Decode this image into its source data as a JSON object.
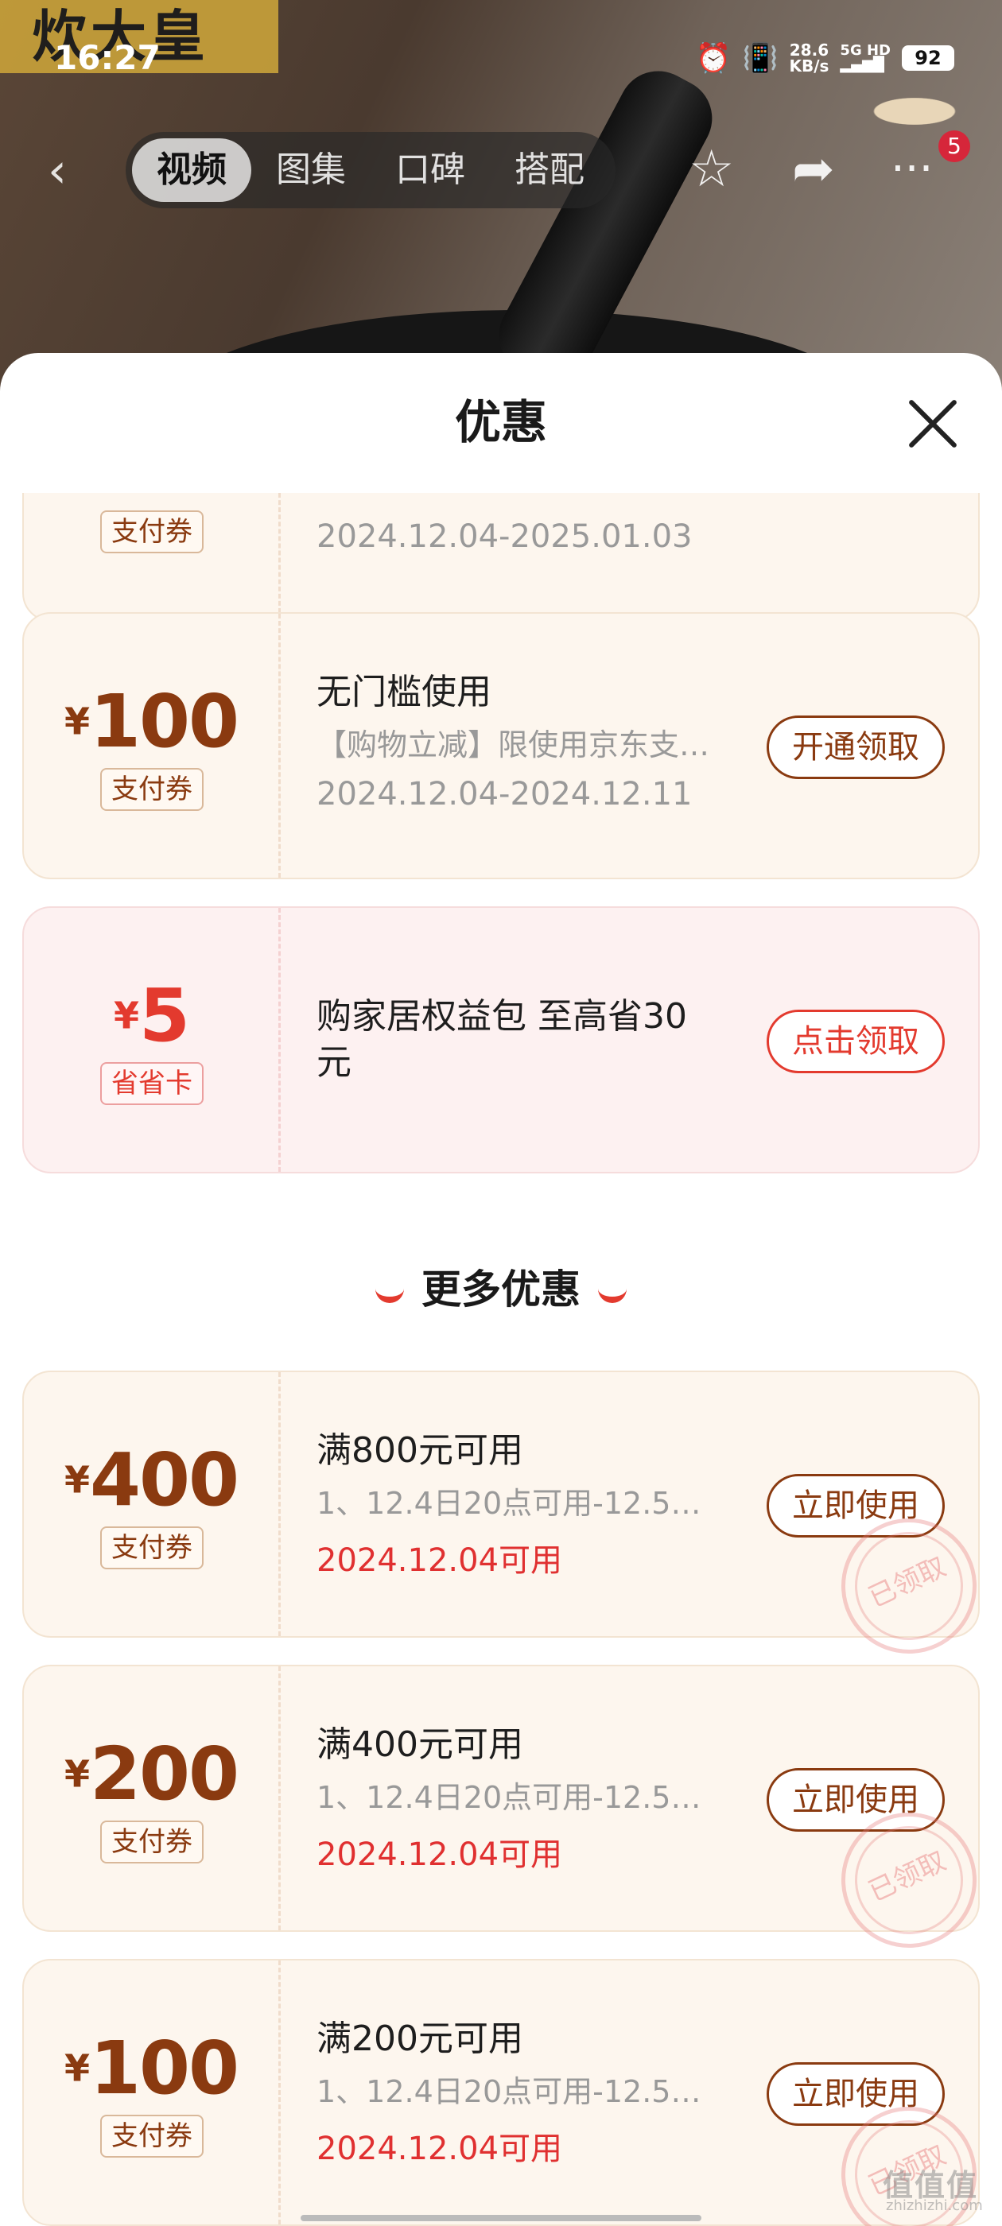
{
  "status_bar": {
    "time": "16:27",
    "net_speed_value": "28.6",
    "net_speed_unit": "KB/s",
    "network": "5G HD",
    "battery": "92"
  },
  "header": {
    "brand": "炊大皇",
    "tabs": [
      {
        "label": "视频",
        "active": true
      },
      {
        "label": "图集",
        "active": false
      },
      {
        "label": "口碑",
        "active": false
      },
      {
        "label": "搭配",
        "active": false
      }
    ],
    "badge_count": "5"
  },
  "sheet": {
    "title": "优惠",
    "partial_coupon": {
      "tag": "支付券",
      "date": "2024.12.04-2025.01.03"
    },
    "coupons": [
      {
        "currency": "¥",
        "amount": "100",
        "tag": "支付券",
        "title": "无门槛使用",
        "desc": "【购物立减】限使用京东支…",
        "date": "2024.12.04-2024.12.11",
        "button": "开通领取"
      },
      {
        "currency": "¥",
        "amount": "5",
        "tag": "省省卡",
        "title": "购家居权益包 至高省30",
        "title_line2": "元",
        "button": "点击领取"
      }
    ],
    "more_section_title": "更多优惠",
    "more_coupons": [
      {
        "currency": "¥",
        "amount": "400",
        "tag": "支付券",
        "title": "满800元可用",
        "desc": "1、12.4日20点可用-12.5…",
        "date": "2024.12.04可用",
        "button": "立即使用",
        "stamp": "已领取"
      },
      {
        "currency": "¥",
        "amount": "200",
        "tag": "支付券",
        "title": "满400元可用",
        "desc": "1、12.4日20点可用-12.5…",
        "date": "2024.12.04可用",
        "button": "立即使用",
        "stamp": "已领取"
      },
      {
        "currency": "¥",
        "amount": "100",
        "tag": "支付券",
        "title": "满200元可用",
        "desc": "1、12.4日20点可用-12.5…",
        "date": "2024.12.04可用",
        "button": "立即使用",
        "stamp": "已领取"
      }
    ]
  },
  "watermark": {
    "text": "值值值",
    "sub": "zhizhizhi.com"
  },
  "colors": {
    "brown_accent": "#8a3a10",
    "red_accent": "#e33a2e",
    "coupon_bg": "#fdf6ee"
  }
}
